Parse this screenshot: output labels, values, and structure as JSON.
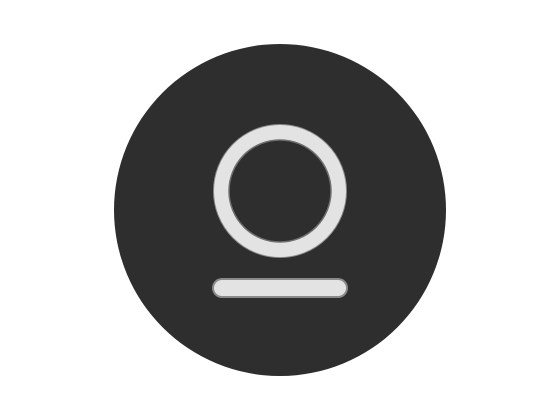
{
  "icon": {
    "name": "user-account-icon",
    "colors": {
      "page_background": "#ffffff",
      "disc_fill": "#2e2e2e",
      "glyph_stroke": "#e3e3e3",
      "glyph_outline": "#8a8a8a"
    }
  }
}
